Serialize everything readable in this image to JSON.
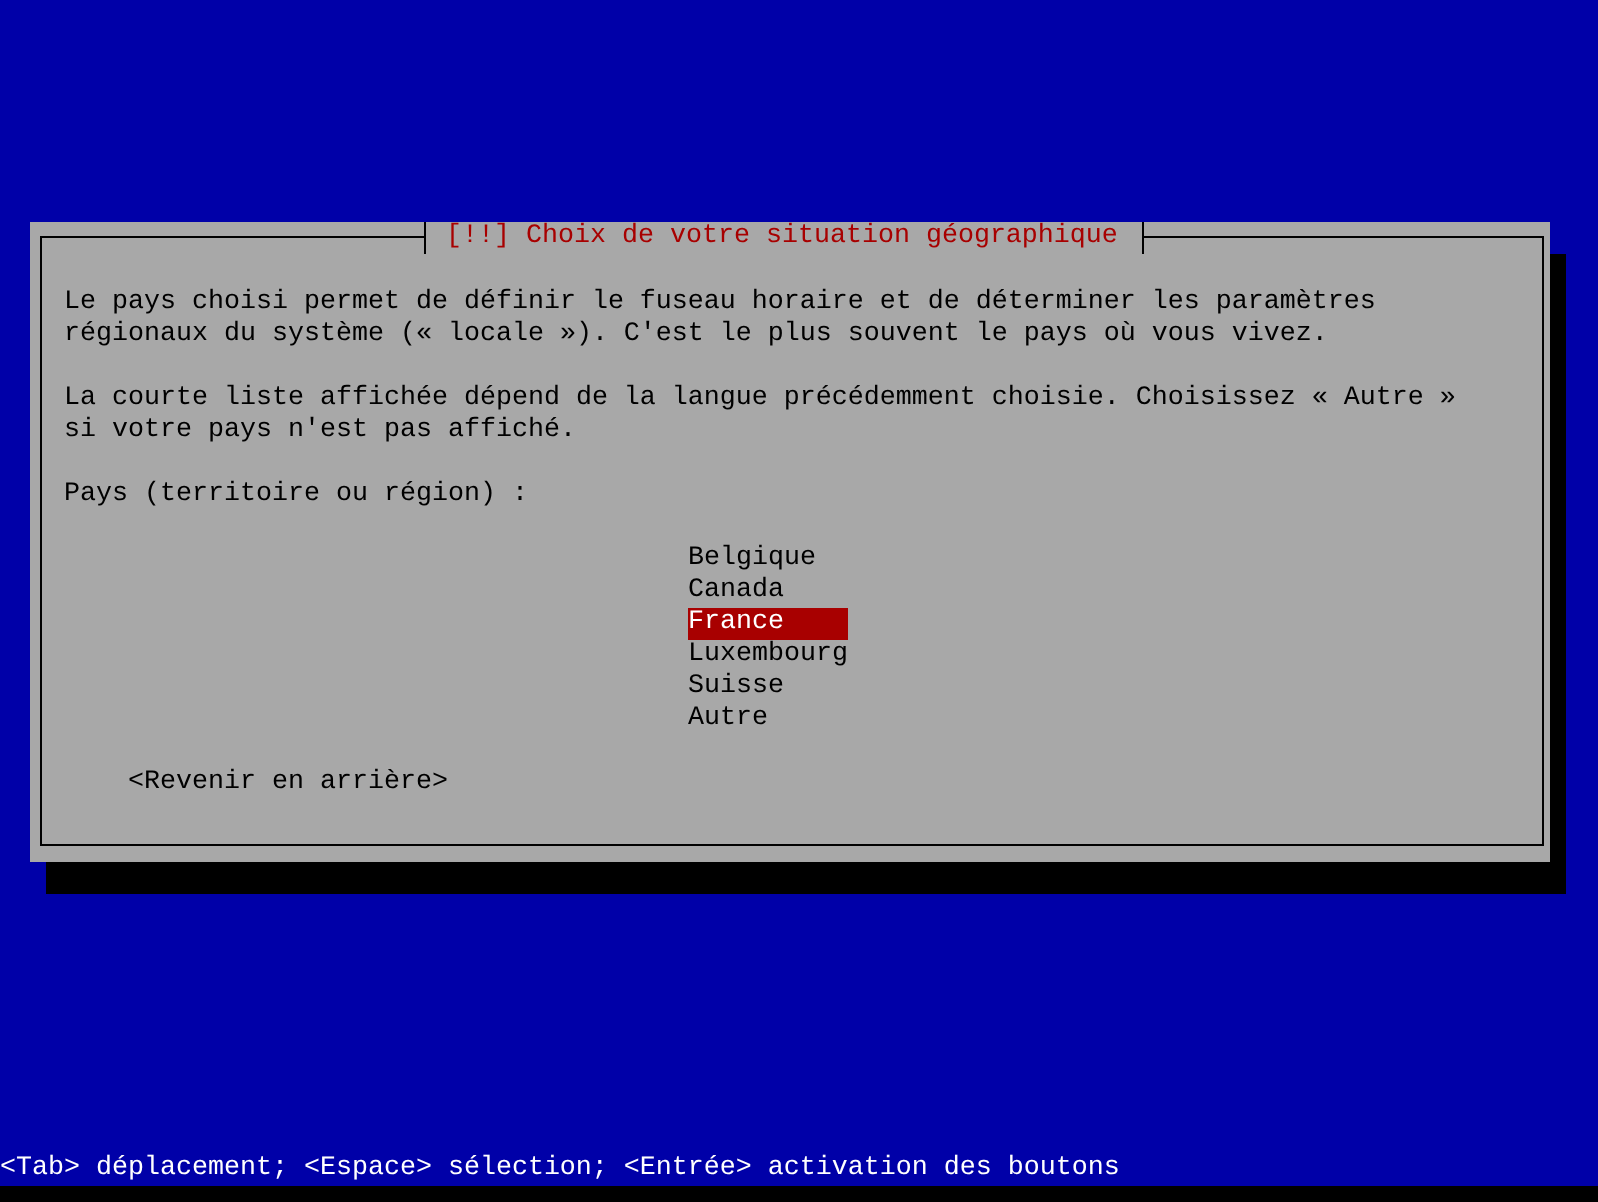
{
  "dialog": {
    "title": "[!!] Choix de votre situation géographique",
    "paragraphs": [
      "Le pays choisi permet de définir le fuseau horaire et de déterminer les paramètres\nrégionaux du système (« locale »). C'est le plus souvent le pays où vous vivez.",
      "La courte liste affichée dépend de la langue précédemment choisie. Choisissez « Autre »\nsi votre pays n'est pas affiché."
    ],
    "prompt": "Pays (territoire ou région) :",
    "options": [
      {
        "label": "Belgique",
        "selected": false
      },
      {
        "label": "Canada",
        "selected": false
      },
      {
        "label": "France",
        "selected": true
      },
      {
        "label": "Luxembourg",
        "selected": false
      },
      {
        "label": "Suisse",
        "selected": false
      },
      {
        "label": "Autre",
        "selected": false
      }
    ],
    "buttons": [
      {
        "label": "<Revenir en arrière>"
      }
    ]
  },
  "status_bar": "<Tab> déplacement; <Espace> sélection; <Entrée> activation des boutons"
}
